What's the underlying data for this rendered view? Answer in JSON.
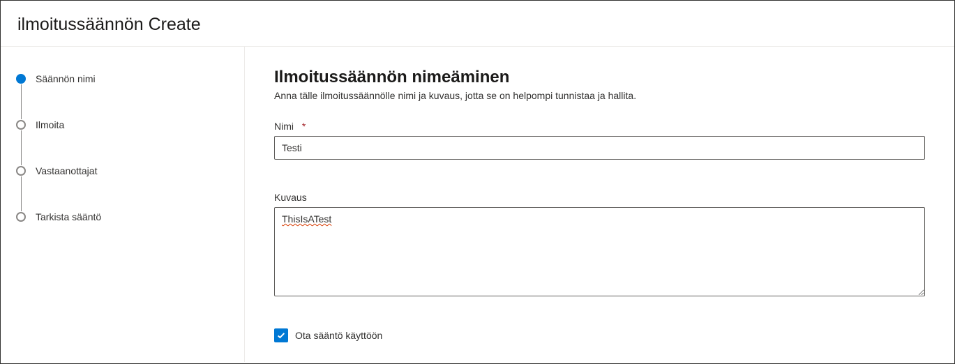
{
  "header": {
    "title": "ilmoitussäännön Create"
  },
  "sidebar": {
    "steps": [
      {
        "label": "Säännön nimi",
        "active": true
      },
      {
        "label": "Ilmoita",
        "active": false
      },
      {
        "label": "Vastaanottajat",
        "active": false
      },
      {
        "label": "Tarkista sääntö",
        "active": false
      }
    ]
  },
  "main": {
    "title": "Ilmoitussäännön nimeäminen",
    "subtitle": "Anna tälle ilmoitussäännölle nimi ja kuvaus, jotta se on helpompi tunnistaa ja hallita.",
    "name_field": {
      "label": "Nimi",
      "required_mark": "*",
      "value": "Testi"
    },
    "description_field": {
      "label": "Kuvaus",
      "value": "ThisIsATest"
    },
    "enable_checkbox": {
      "label": "Ota sääntö käyttöön",
      "checked": true
    }
  }
}
